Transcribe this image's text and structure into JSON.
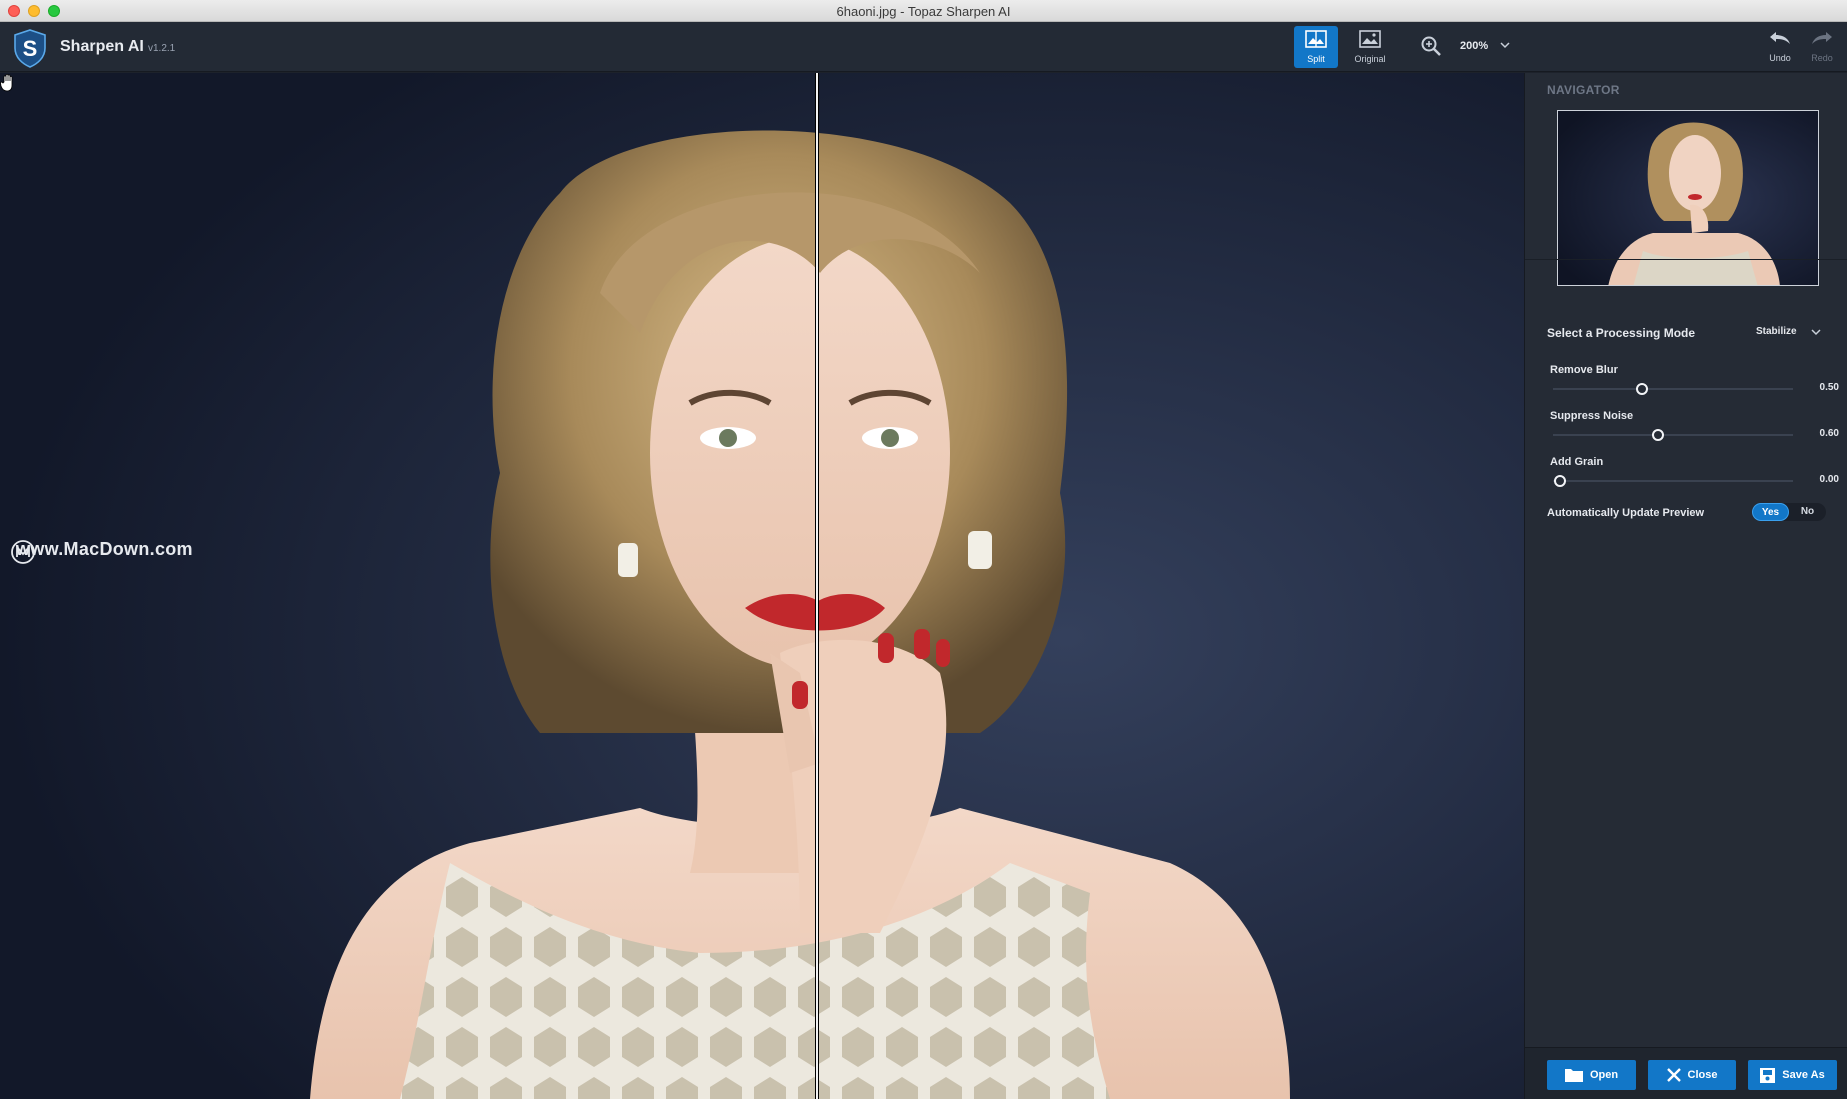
{
  "window": {
    "title": "6haoni.jpg - Topaz Sharpen AI"
  },
  "app": {
    "name": "Sharpen AI",
    "version": "v1.2.1"
  },
  "toolbar": {
    "split_label": "Split",
    "original_label": "Original",
    "zoom_value": "200%",
    "undo_label": "Undo",
    "redo_label": "Redo"
  },
  "canvas": {
    "watermark": "www.MacDown.com"
  },
  "panel": {
    "navigator_title": "NAVIGATOR",
    "mode_label": "Select a Processing Mode",
    "mode_value": "Stabilize",
    "sliders": [
      {
        "label": "Remove Blur",
        "value": "0.50",
        "level": 0.5
      },
      {
        "label": "Suppress Noise",
        "value": "0.60",
        "level": 0.6
      },
      {
        "label": "Add Grain",
        "value": "0.00",
        "level": 0.0
      }
    ],
    "auto_update_label": "Automatically Update Preview",
    "auto_update_yes": "Yes",
    "auto_update_no": "No"
  },
  "actions": {
    "open": "Open",
    "close": "Close",
    "save_as": "Save As"
  },
  "colors": {
    "accent": "#1277c8",
    "background": "#141a2c",
    "panel": "#252b35"
  }
}
